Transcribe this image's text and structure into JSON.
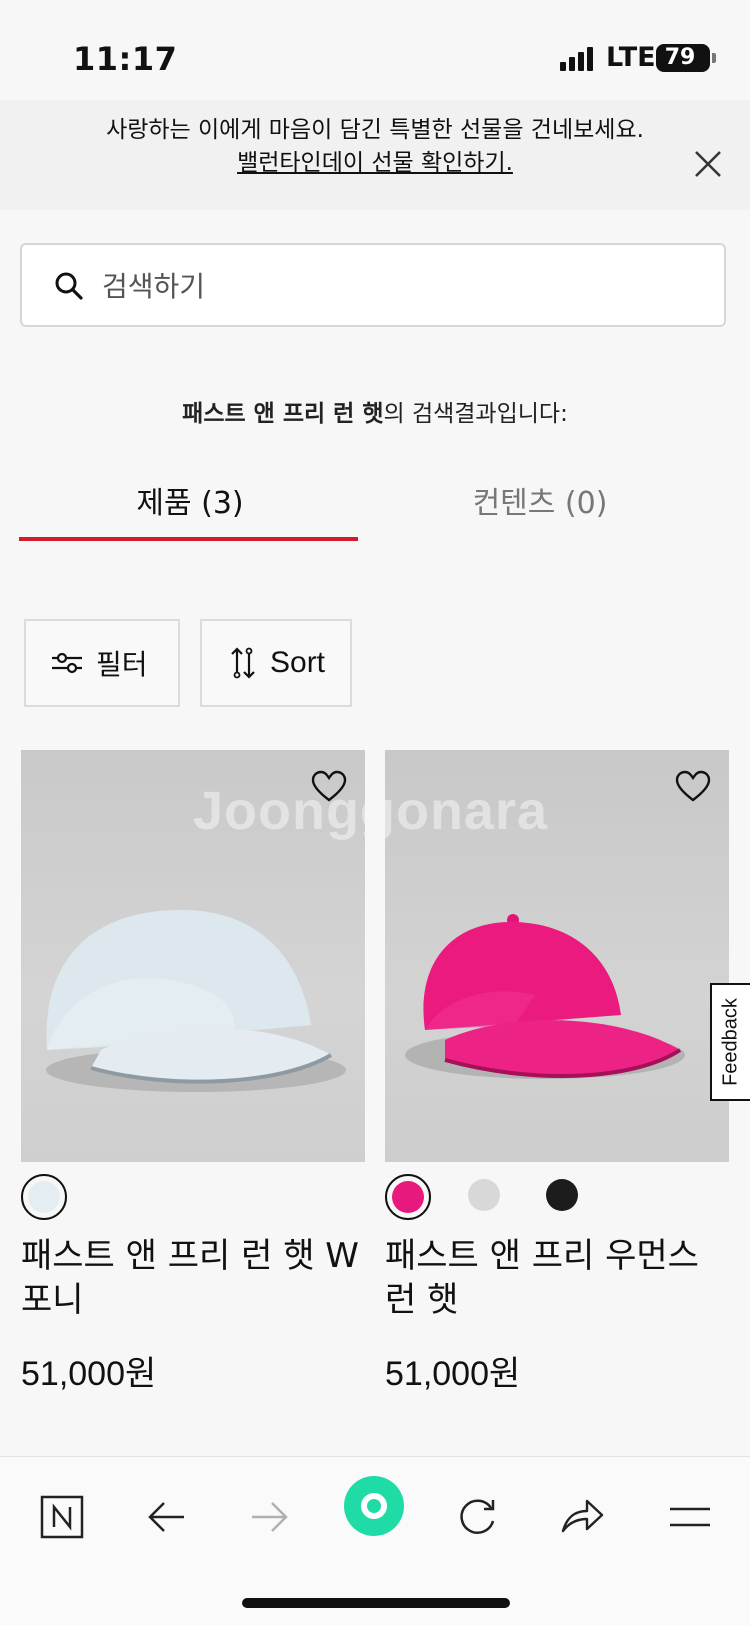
{
  "status_bar": {
    "time": "11:17",
    "network": "LTE",
    "battery": "79"
  },
  "banner": {
    "text": "사랑하는 이에게 마음이 담긴 특별한 선물을 건네보세요.",
    "link": "밸런타인데이 선물 확인하기."
  },
  "search": {
    "placeholder": "검색하기",
    "value": ""
  },
  "results": {
    "query": "패스트 앤 프리 런 햇",
    "suffix": "의 검색결과입니다:"
  },
  "tabs": [
    {
      "label": "제품 (3)",
      "active": true
    },
    {
      "label": "컨텐츠 (0)",
      "active": false
    }
  ],
  "controls": {
    "filter_label": "필터",
    "sort_label": "Sort"
  },
  "watermark": "Joonggonara",
  "products": [
    {
      "name": "패스트 앤 프리 런 햇 W 포니",
      "price": "51,000원",
      "swatches": [
        "#e4eef2"
      ],
      "selected_swatch": 0,
      "cap_color": "#dfe9f0"
    },
    {
      "name": "패스트 앤 프리 우먼스 런 햇",
      "price": "51,000원",
      "swatches": [
        "#e8197d",
        "#d8d8d8",
        "#1c1c1c"
      ],
      "selected_swatch": 0,
      "cap_color": "#ea1a7f"
    }
  ],
  "feedback_label": "Feedback",
  "toolbar": [
    "n-logo-icon",
    "back-arrow-icon",
    "forward-arrow-icon",
    "home-circle-icon",
    "refresh-icon",
    "share-icon",
    "menu-icon"
  ],
  "colors": {
    "accent": "#d31c2b",
    "home": "#1fdca6"
  }
}
